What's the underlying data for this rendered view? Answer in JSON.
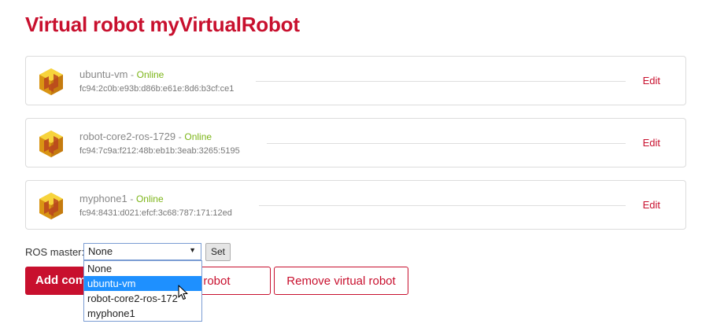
{
  "page_title": "Virtual robot myVirtualRobot",
  "devices": [
    {
      "name": "ubuntu-vm",
      "separator": "-",
      "status": "Online",
      "id": "fc94:2c0b:e93b:d86b:e61e:8d6:b3cf:ce1",
      "edit_label": "Edit"
    },
    {
      "name": "robot-core2-ros-1729",
      "separator": "-",
      "status": "Online",
      "id": "fc94:7c9a:f212:48b:eb1b:3eab:3265:5195",
      "edit_label": "Edit"
    },
    {
      "name": "myphone1",
      "separator": "-",
      "status": "Online",
      "id": "fc94:8431:d021:efcf:3c68:787:171:12ed",
      "edit_label": "Edit"
    }
  ],
  "ros_master": {
    "label": "ROS master:",
    "selected": "None",
    "set_label": "Set",
    "options": [
      "None",
      "ubuntu-vm",
      "robot-core2-ros-172",
      "myphone1"
    ],
    "highlighted_option": "ubuntu-vm"
  },
  "actions": {
    "add_label": "Add com",
    "rename_label": "rtual robot",
    "remove_label": "Remove virtual robot"
  },
  "icons": {
    "device": "robot-cube-icon",
    "dropdown": "chevron-down-icon",
    "cursor": "mouse-pointer-icon"
  },
  "colors": {
    "brand": "#c8102e",
    "online": "#7cb518",
    "selection": "#1e90ff"
  }
}
